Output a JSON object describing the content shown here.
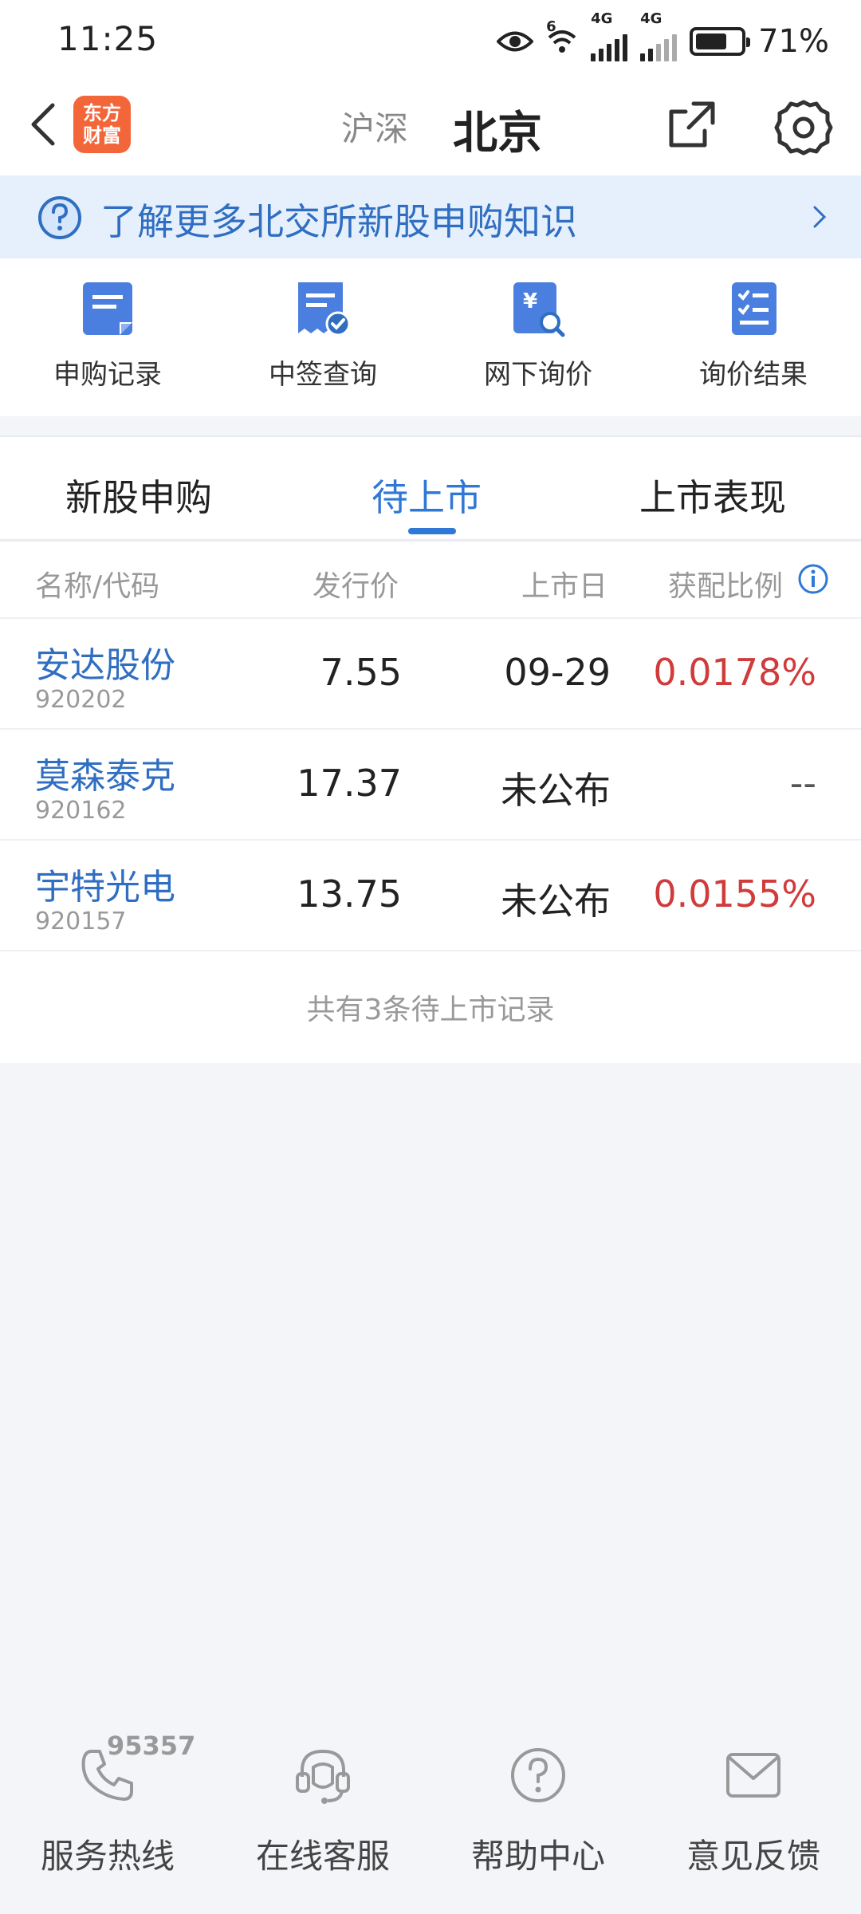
{
  "status_bar": {
    "time": "11:25",
    "network1": "4G",
    "network2": "4G",
    "wifi_tag": "6",
    "battery_percent_text": "71%",
    "battery_level": 0.71
  },
  "header": {
    "logo_line1": "东方",
    "logo_line2": "财富",
    "tab_shanghai_shenzhen": "沪深",
    "tab_beijing": "北京"
  },
  "banner": {
    "text": "了解更多北交所新股申购知识"
  },
  "quick_menu": [
    {
      "label": "申购记录",
      "icon": "document-icon"
    },
    {
      "label": "中签查询",
      "icon": "receipt-check-icon"
    },
    {
      "label": "网下询价",
      "icon": "price-search-icon"
    },
    {
      "label": "询价结果",
      "icon": "checklist-icon"
    }
  ],
  "tabs": [
    {
      "label": "新股申购",
      "active": false
    },
    {
      "label": "待上市",
      "active": true
    },
    {
      "label": "上市表现",
      "active": false
    }
  ],
  "table": {
    "headers": {
      "name": "名称/代码",
      "price": "发行价",
      "date": "上市日",
      "ratio": "获配比例"
    },
    "rows": [
      {
        "name": "安达股份",
        "code": "920202",
        "price": "7.55",
        "date": "09-29",
        "ratio": "0.0178%"
      },
      {
        "name": "莫森泰克",
        "code": "920162",
        "price": "17.37",
        "date": "未公布",
        "ratio": "--"
      },
      {
        "name": "宇特光电",
        "code": "920157",
        "price": "13.75",
        "date": "未公布",
        "ratio": "0.0155%"
      }
    ],
    "footer": "共有3条待上市记录"
  },
  "bottom_bar": {
    "hotline_number": "95357",
    "items": [
      {
        "label": "服务热线",
        "icon": "phone-icon"
      },
      {
        "label": "在线客服",
        "icon": "headset-icon"
      },
      {
        "label": "帮助中心",
        "icon": "help-icon"
      },
      {
        "label": "意见反馈",
        "icon": "mail-icon"
      }
    ]
  },
  "colors": {
    "accent": "#2f78d6",
    "link": "#2f6ec1",
    "positive": "#d03b3b",
    "logo": "#f2663a",
    "banner_bg": "#e6f0fd"
  }
}
